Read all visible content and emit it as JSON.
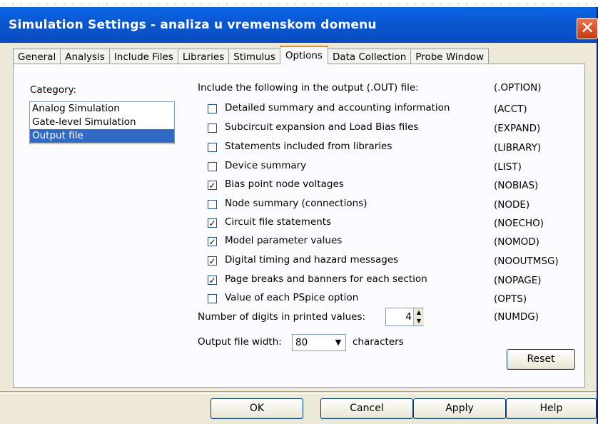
{
  "window": {
    "title": "Simulation Settings - analiza u vremenskom domenu",
    "close_glyph": "✕"
  },
  "tabs": [
    {
      "label": "General"
    },
    {
      "label": "Analysis"
    },
    {
      "label": "Include Files"
    },
    {
      "label": "Libraries"
    },
    {
      "label": "Stimulus"
    },
    {
      "label": "Options",
      "active": true
    },
    {
      "label": "Data Collection"
    },
    {
      "label": "Probe Window"
    }
  ],
  "category": {
    "label": "Category:",
    "items": [
      "Analog Simulation",
      "Gate-level Simulation",
      "Output file"
    ],
    "selected": "Output file"
  },
  "output": {
    "header": "Include the following in the output (.OUT) file:",
    "header_code": "(.OPTION)",
    "options": [
      {
        "label": "Detailed summary and accounting information",
        "code": "(ACCT)",
        "checked": false
      },
      {
        "label": "Subcircuit expansion and Load Bias files",
        "code": "(EXPAND)",
        "checked": false
      },
      {
        "label": "Statements included from libraries",
        "code": "(LIBRARY)",
        "checked": false
      },
      {
        "label": "Device summary",
        "code": "(LIST)",
        "checked": false
      },
      {
        "label": "Bias point node voltages",
        "code": "(NOBIAS)",
        "checked": true
      },
      {
        "label": "Node summary (connections)",
        "code": "(NODE)",
        "checked": false
      },
      {
        "label": "Circuit file statements",
        "code": "(NOECHO)",
        "checked": true
      },
      {
        "label": "Model parameter values",
        "code": "(NOMOD)",
        "checked": true
      },
      {
        "label": "Digital timing and hazard messages",
        "code": "(NOOUTMSG)",
        "checked": true
      },
      {
        "label": "Page breaks and banners for each section",
        "code": "(NOPAGE)",
        "checked": true
      },
      {
        "label": "Value of each PSpice option",
        "code": "(OPTS)",
        "checked": false
      }
    ],
    "digits_label": "Number of digits in printed values:",
    "digits_value": "4",
    "digits_code": "(NUMDG)",
    "width_label": "Output file width:",
    "width_value": "80",
    "width_suffix": "characters",
    "reset_label": "Reset"
  },
  "footer": {
    "ok": "OK",
    "cancel": "Cancel",
    "apply": "Apply",
    "help": "Help"
  },
  "colors": {
    "titlebar": "#0a5fd8",
    "selection": "#316ac5",
    "active_tab_accent": "#e68b2c",
    "close_button": "#d34f26"
  }
}
